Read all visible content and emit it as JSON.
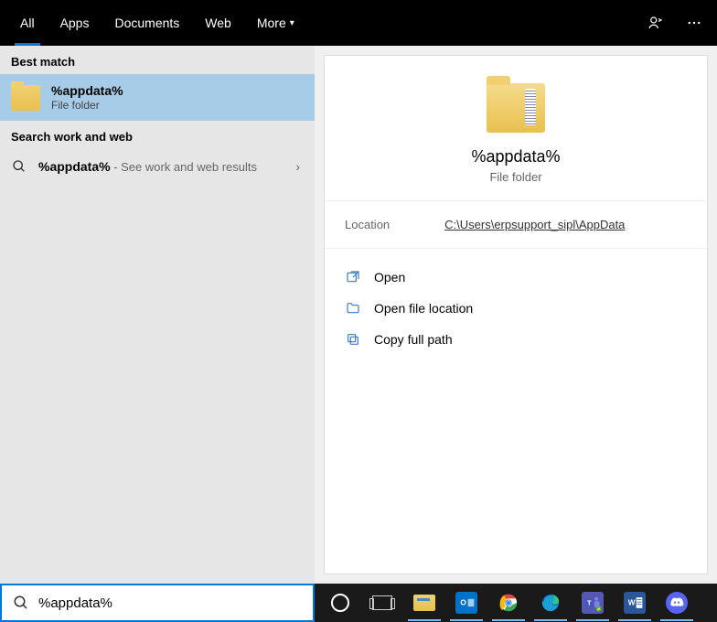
{
  "tabs": {
    "items": [
      "All",
      "Apps",
      "Documents",
      "Web",
      "More"
    ],
    "active_index": 0
  },
  "left_pane": {
    "best_match_header": "Best match",
    "best_match": {
      "title": "%appdata%",
      "subtitle": "File folder"
    },
    "search_section_header": "Search work and web",
    "search_result": {
      "query": "%appdata%",
      "hint": " - See work and web results"
    }
  },
  "preview": {
    "title": "%appdata%",
    "subtitle": "File folder",
    "location_label": "Location",
    "location_value": "C:\\Users\\erpsupport_sipl\\AppData",
    "actions": [
      {
        "icon": "open",
        "label": "Open"
      },
      {
        "icon": "folder-open",
        "label": "Open file location"
      },
      {
        "icon": "copy",
        "label": "Copy full path"
      }
    ]
  },
  "search_box": {
    "value": "%appdata%"
  },
  "taskbar": {
    "items": [
      {
        "name": "cortana",
        "open": false
      },
      {
        "name": "task-view",
        "open": false
      },
      {
        "name": "file-explorer",
        "open": true,
        "bg": "#f0d070"
      },
      {
        "name": "outlook",
        "open": true,
        "bg": "#0072c6",
        "text": "O"
      },
      {
        "name": "chrome",
        "open": true
      },
      {
        "name": "edge",
        "open": true
      },
      {
        "name": "teams",
        "open": true,
        "bg": "#5558af",
        "text": "T"
      },
      {
        "name": "word",
        "open": true,
        "bg": "#2b579a",
        "text": "W"
      },
      {
        "name": "discord",
        "open": true,
        "bg": "#5865f2"
      }
    ]
  }
}
